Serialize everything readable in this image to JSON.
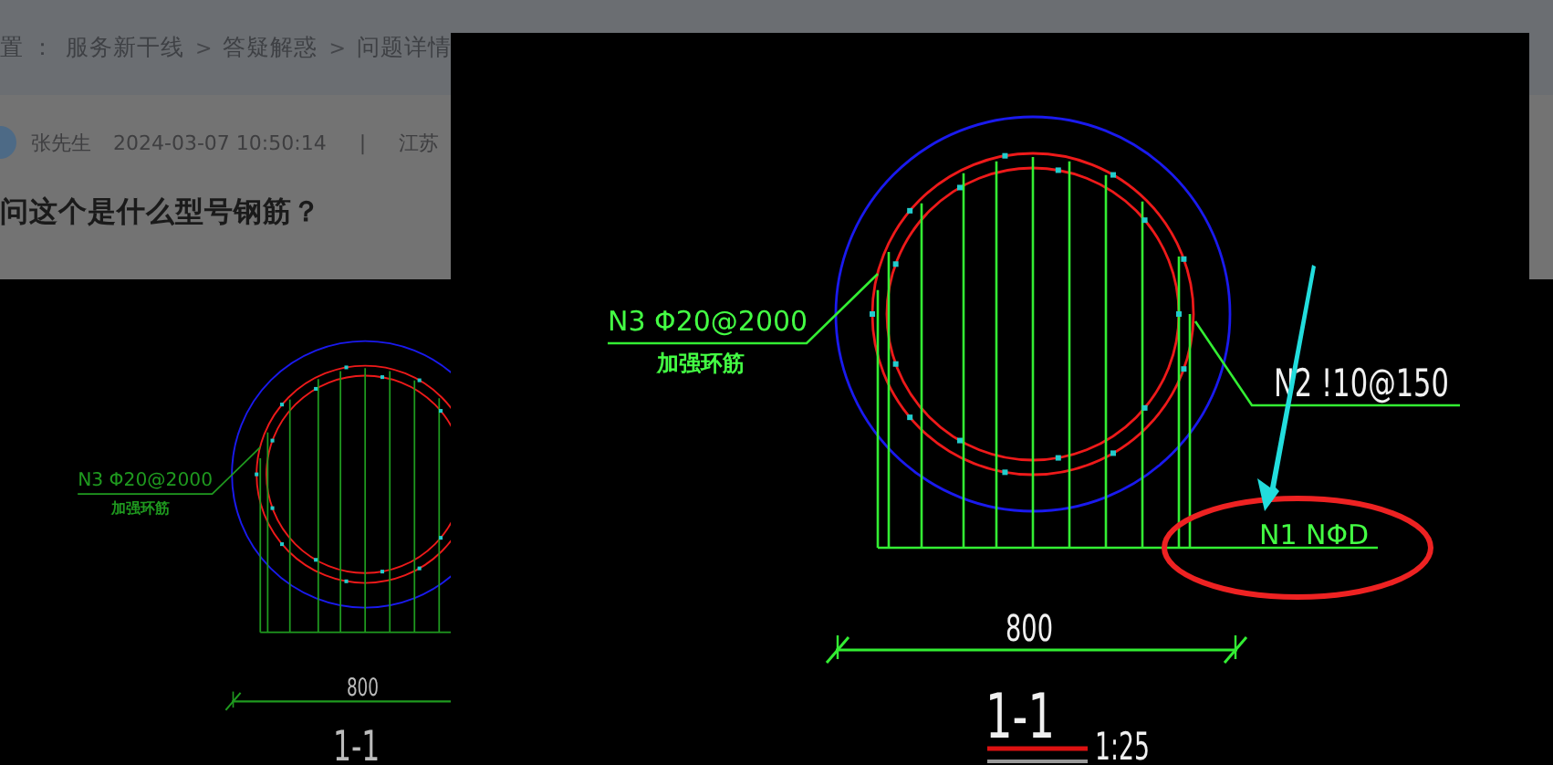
{
  "breadcrumb": {
    "lead": "置 ：",
    "items": [
      {
        "label": "服务新干线"
      },
      {
        "label": "答疑解惑"
      },
      {
        "label": "问题详情"
      }
    ],
    "separator": ">"
  },
  "post": {
    "author": "张先生",
    "time": "2024-03-07 10:50:14",
    "divider": "|",
    "location": "江苏",
    "title": "问这个是什么型号钢筋？"
  },
  "question_image": {
    "labels": {
      "callout_left": "N3 Φ20@2000",
      "callout_left_note": "加强环筋",
      "dimension": "800",
      "section_title": "1-1"
    }
  },
  "lightbox": {
    "labels": {
      "callout_left": "N3 Φ20@2000",
      "callout_left_note": "加强环筋",
      "callout_right": "N2 !10@150",
      "callout_bottom": "N1 NΦD",
      "dimension": "800",
      "section_title": "1-1",
      "section_scale": "1:25"
    }
  }
}
